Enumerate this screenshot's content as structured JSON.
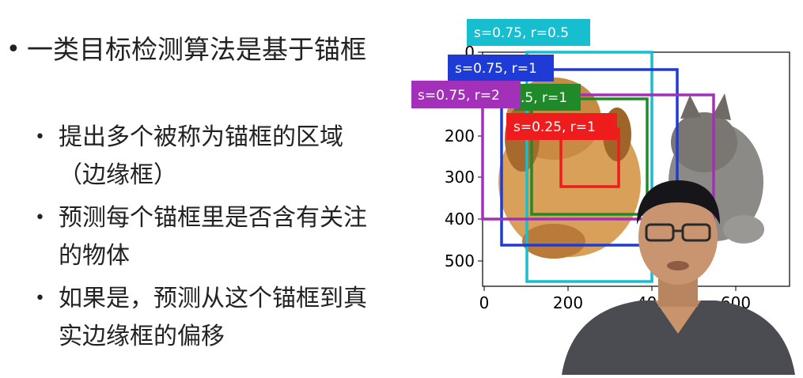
{
  "bullets": {
    "main": "一类目标检测算法是基于锚框",
    "sub": [
      "提出多个被称为锚框的区域（边缘框）",
      "预测每个锚框里是否含有关注的物体",
      "如果是，预测从这个锚框到真实边缘框的偏移"
    ],
    "dot": "•"
  },
  "figure": {
    "x_ticks": [
      "0",
      "200",
      "400",
      "600"
    ],
    "y_ticks": [
      "0",
      "200",
      "300",
      "400",
      "500"
    ],
    "anchors": [
      {
        "label": "s=0.75, r=0.5",
        "color": "#17becf"
      },
      {
        "label": "s=0.75, r=1",
        "color": "#1f3bd6"
      },
      {
        "label": "s=0.75, r=2",
        "color": "#a230b8"
      },
      {
        "label": ".5, r=1",
        "color": "#208a2a"
      },
      {
        "label": "s=0.25, r=1",
        "color": "#ee1c1c"
      }
    ]
  }
}
